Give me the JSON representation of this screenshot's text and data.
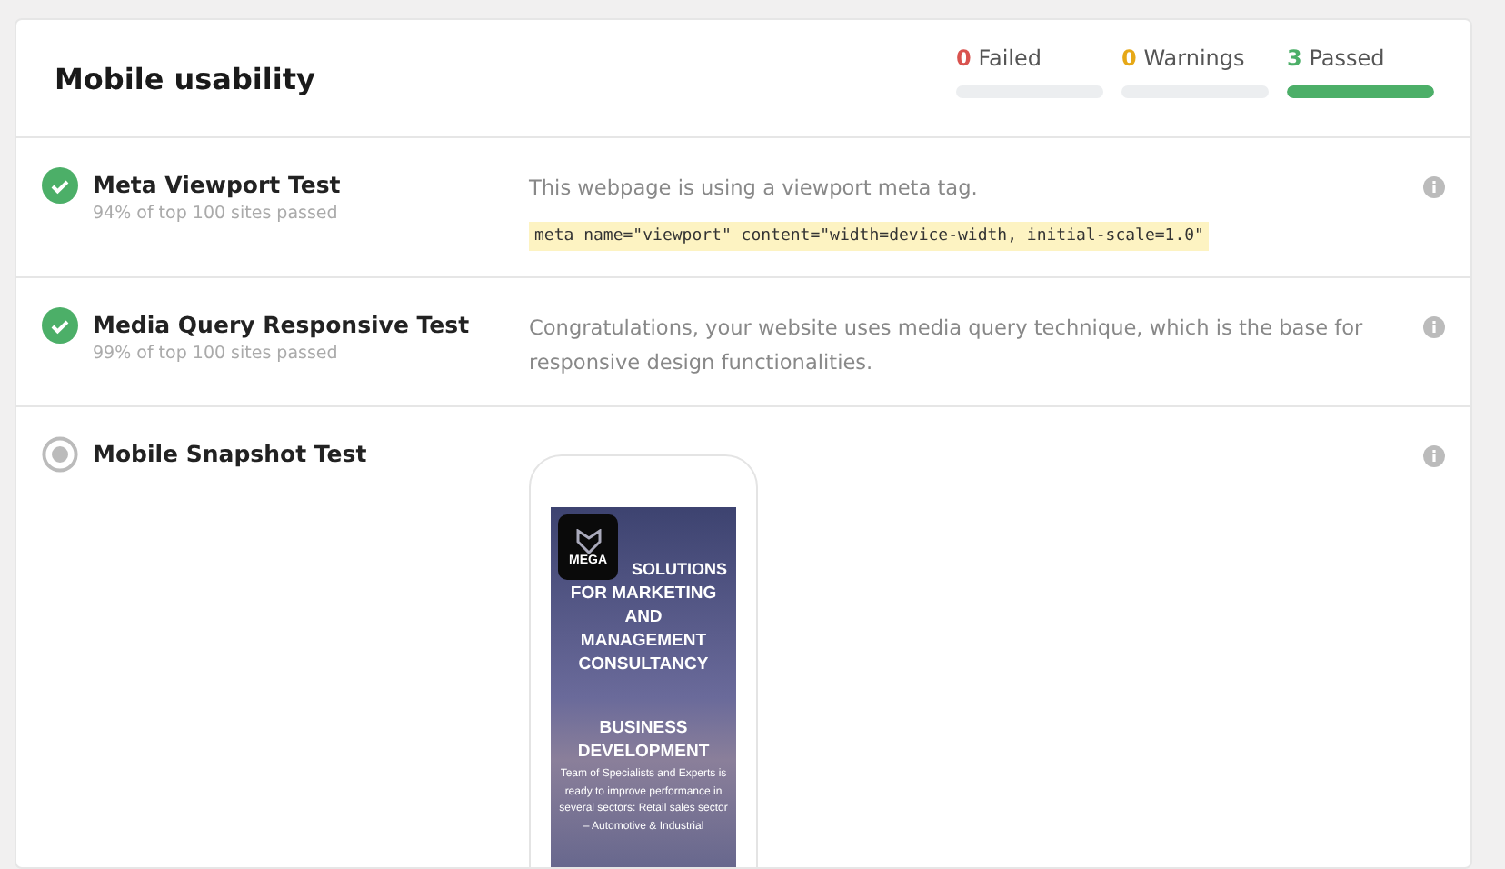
{
  "title": "Mobile usability",
  "summary": [
    {
      "count": "0",
      "label": "Failed",
      "color": "#d9534f",
      "level": 0
    },
    {
      "count": "0",
      "label": "Warnings",
      "color": "#e6a817",
      "level": 0
    },
    {
      "count": "3",
      "label": "Passed",
      "color": "#4caf68",
      "level": 1
    }
  ],
  "tests": [
    {
      "name": "Meta Viewport Test",
      "subtitle": "94% of top 100 sites passed",
      "passed": true,
      "kind": "code",
      "description": "This webpage is using a viewport meta tag.",
      "code": "meta name=\"viewport\" content=\"width=device-width, initial-scale=1.0\""
    },
    {
      "name": "Media Query Responsive Test",
      "subtitle": "99% of top 100 sites passed",
      "passed": true,
      "kind": "text",
      "description": "Congratulations, your website uses media query technique, which is the base for responsive design functionalities."
    },
    {
      "name": "Mobile Snapshot Test",
      "passed": false,
      "kind": "snapshot",
      "snapshot": {
        "logo": "MEGA",
        "headline_start": "SOLUTIONS",
        "headline": "FOR MARKETING AND MANAGEMENT CONSULTANCY",
        "heading": "BUSINESS DEVELOPMENT",
        "body": "Team of Specialists and Experts is ready to improve performance in several sectors: Retail sales sector – Automotive & Industrial"
      }
    }
  ]
}
